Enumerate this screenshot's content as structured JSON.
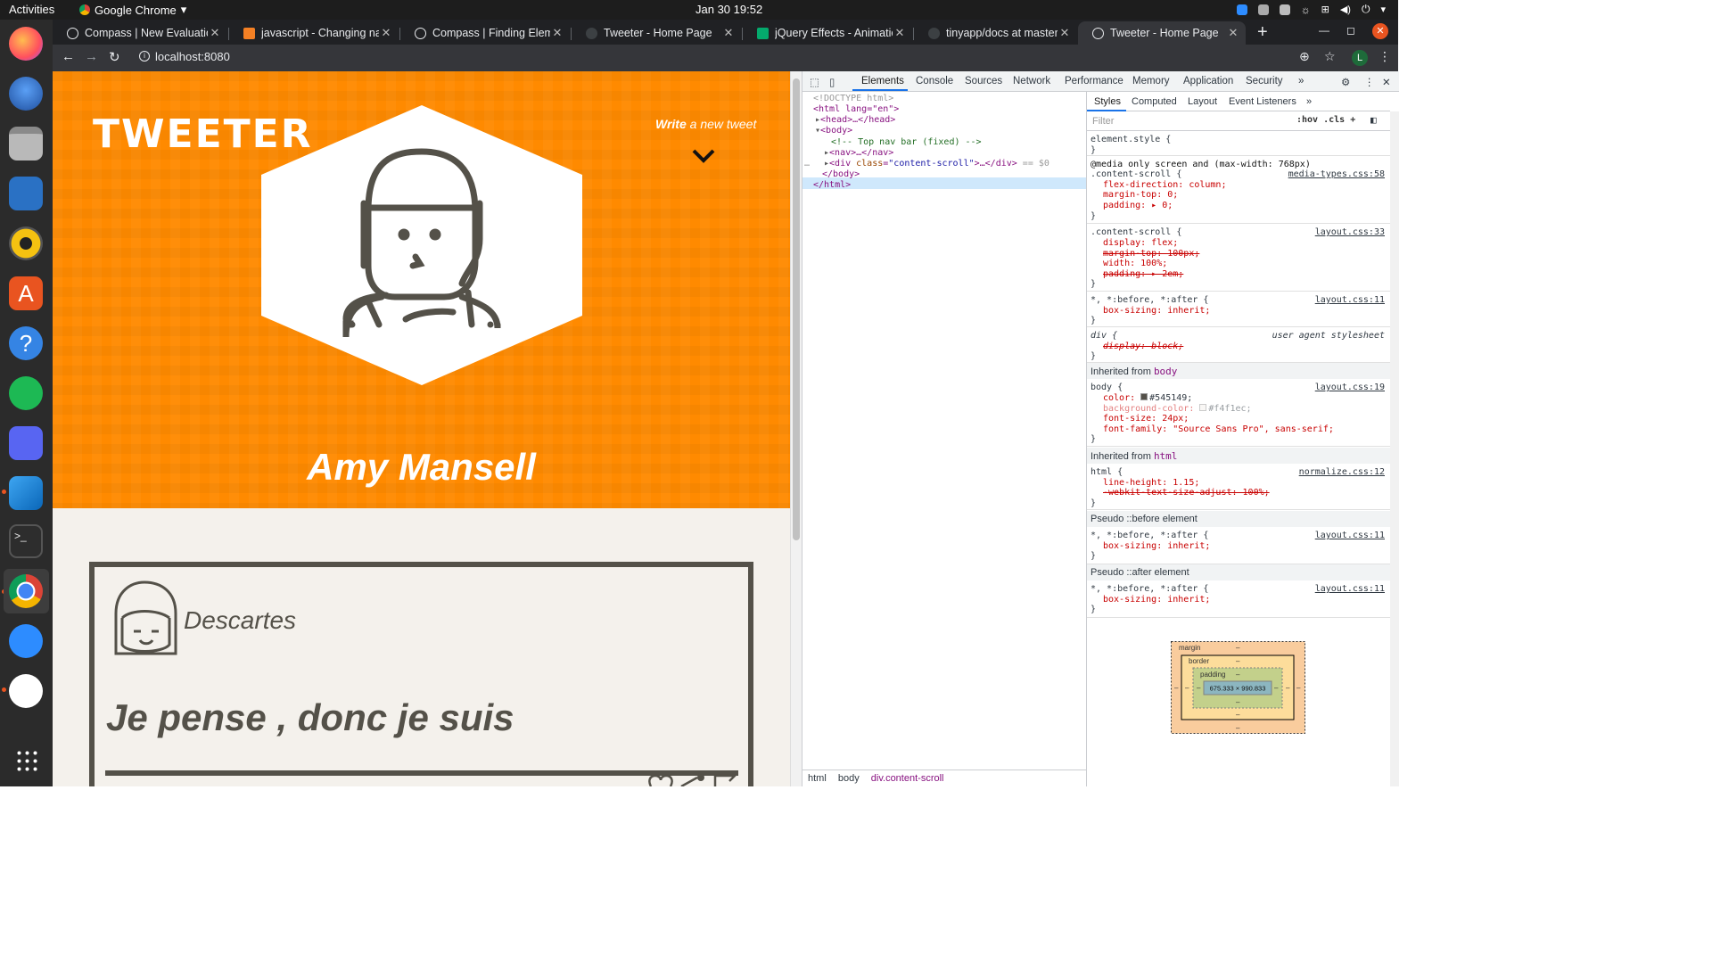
{
  "os": {
    "activities": "Activities",
    "app_name": "Google Chrome",
    "clock": "Jan 30  19:52"
  },
  "tabs": [
    {
      "title": "Compass | New Evaluatio",
      "favicon_color": "#e8eaed"
    },
    {
      "title": "javascript - Changing nav",
      "favicon_color": "#f48024"
    },
    {
      "title": "Compass | Finding Eleme",
      "favicon_color": "#e8eaed"
    },
    {
      "title": "Tweeter - Home Page",
      "favicon_color": "#5f6368"
    },
    {
      "title": "jQuery Effects - Animatio",
      "favicon_color": "#04aa6d"
    },
    {
      "title": "tinyapp/docs at master ·",
      "favicon_color": "#5f6368"
    },
    {
      "title": "Tweeter - Home Page",
      "favicon_color": "#5f6368",
      "active": true
    }
  ],
  "toolbar": {
    "url": "localhost:8080",
    "profile_initial": "L"
  },
  "page": {
    "logo": "TWEETER",
    "write_bold": "Write",
    "write_rest": "a new tweet",
    "username": "Amy Mansell",
    "tweet": {
      "author": "Descartes",
      "content": "Je pense , donc je suis"
    },
    "accent_color": "#ff8a00",
    "text_color": "#545149"
  },
  "devtools": {
    "tabs": [
      "Elements",
      "Console",
      "Sources",
      "Network",
      "Performance",
      "Memory",
      "Application",
      "Security",
      "»"
    ],
    "active_tab": "Elements",
    "dom": {
      "doctype": "<!DOCTYPE html>",
      "html_open": "<html lang=\"en\">",
      "head": "<head>…</head>",
      "body_open": "<body>",
      "comment": "<!-- Top nav bar (fixed) -->",
      "nav": "<nav>…</nav>",
      "div_tag": "<div ",
      "div_attr": "class",
      "div_val": "\"content-scroll\"",
      "div_rest": ">…</div>",
      "div_eq": " == $0",
      "body_close": "</body>",
      "html_close": "</html>",
      "ellipsis": "…"
    },
    "breadcrumb": [
      "html",
      "body",
      "div.content-scroll"
    ],
    "styles_tabs": [
      "Styles",
      "Computed",
      "Layout",
      "Event Listeners",
      "»"
    ],
    "filter_placeholder": "Filter",
    "filter_buttons": ":hov  .cls  +",
    "rules": {
      "element_style": "element.style {",
      "close": "}",
      "media": "@media only screen and (max-width: 768px)",
      "media_selector": ".content-scroll {",
      "media_src": "media-types.css:58",
      "media_props": [
        "flex-direction: column;",
        "margin-top: 0;",
        "padding: ▸ 0;"
      ],
      "cs_selector": ".content-scroll {",
      "cs_src": "layout.css:33",
      "cs_props": [
        "display: flex;",
        "margin-top: 100px;",
        "width: 100%;",
        "padding: ▸ 2em;"
      ],
      "star_selector": "*, *:before, *:after {",
      "star_src": "layout.css:11",
      "star_prop": "box-sizing: inherit;",
      "div_selector": "div {",
      "div_src": "user agent stylesheet",
      "div_prop": "display: block;",
      "inherited_body": "Inherited from",
      "inherited_body_tag": "body",
      "body_selector": "body {",
      "body_src": "layout.css:19",
      "body_props": [
        "color: ",
        "#545149;",
        "background-color: ",
        "#f4f1ec;",
        "font-size: 24px;",
        "font-family: \"Source Sans Pro\", sans-serif;"
      ],
      "inherited_html": "Inherited from",
      "inherited_html_tag": "html",
      "html_selector": "html {",
      "html_src": "normalize.css:12",
      "html_props": [
        "line-height: 1.15;",
        "-webkit-text-size-adjust: 100%;"
      ],
      "pseudo_before": "Pseudo ::before element",
      "pseudo_after": "Pseudo ::after element"
    },
    "boxmodel": {
      "margin": "margin",
      "border": "border",
      "padding": "padding",
      "dash": "–",
      "content": "675.333 × 990.833"
    }
  }
}
